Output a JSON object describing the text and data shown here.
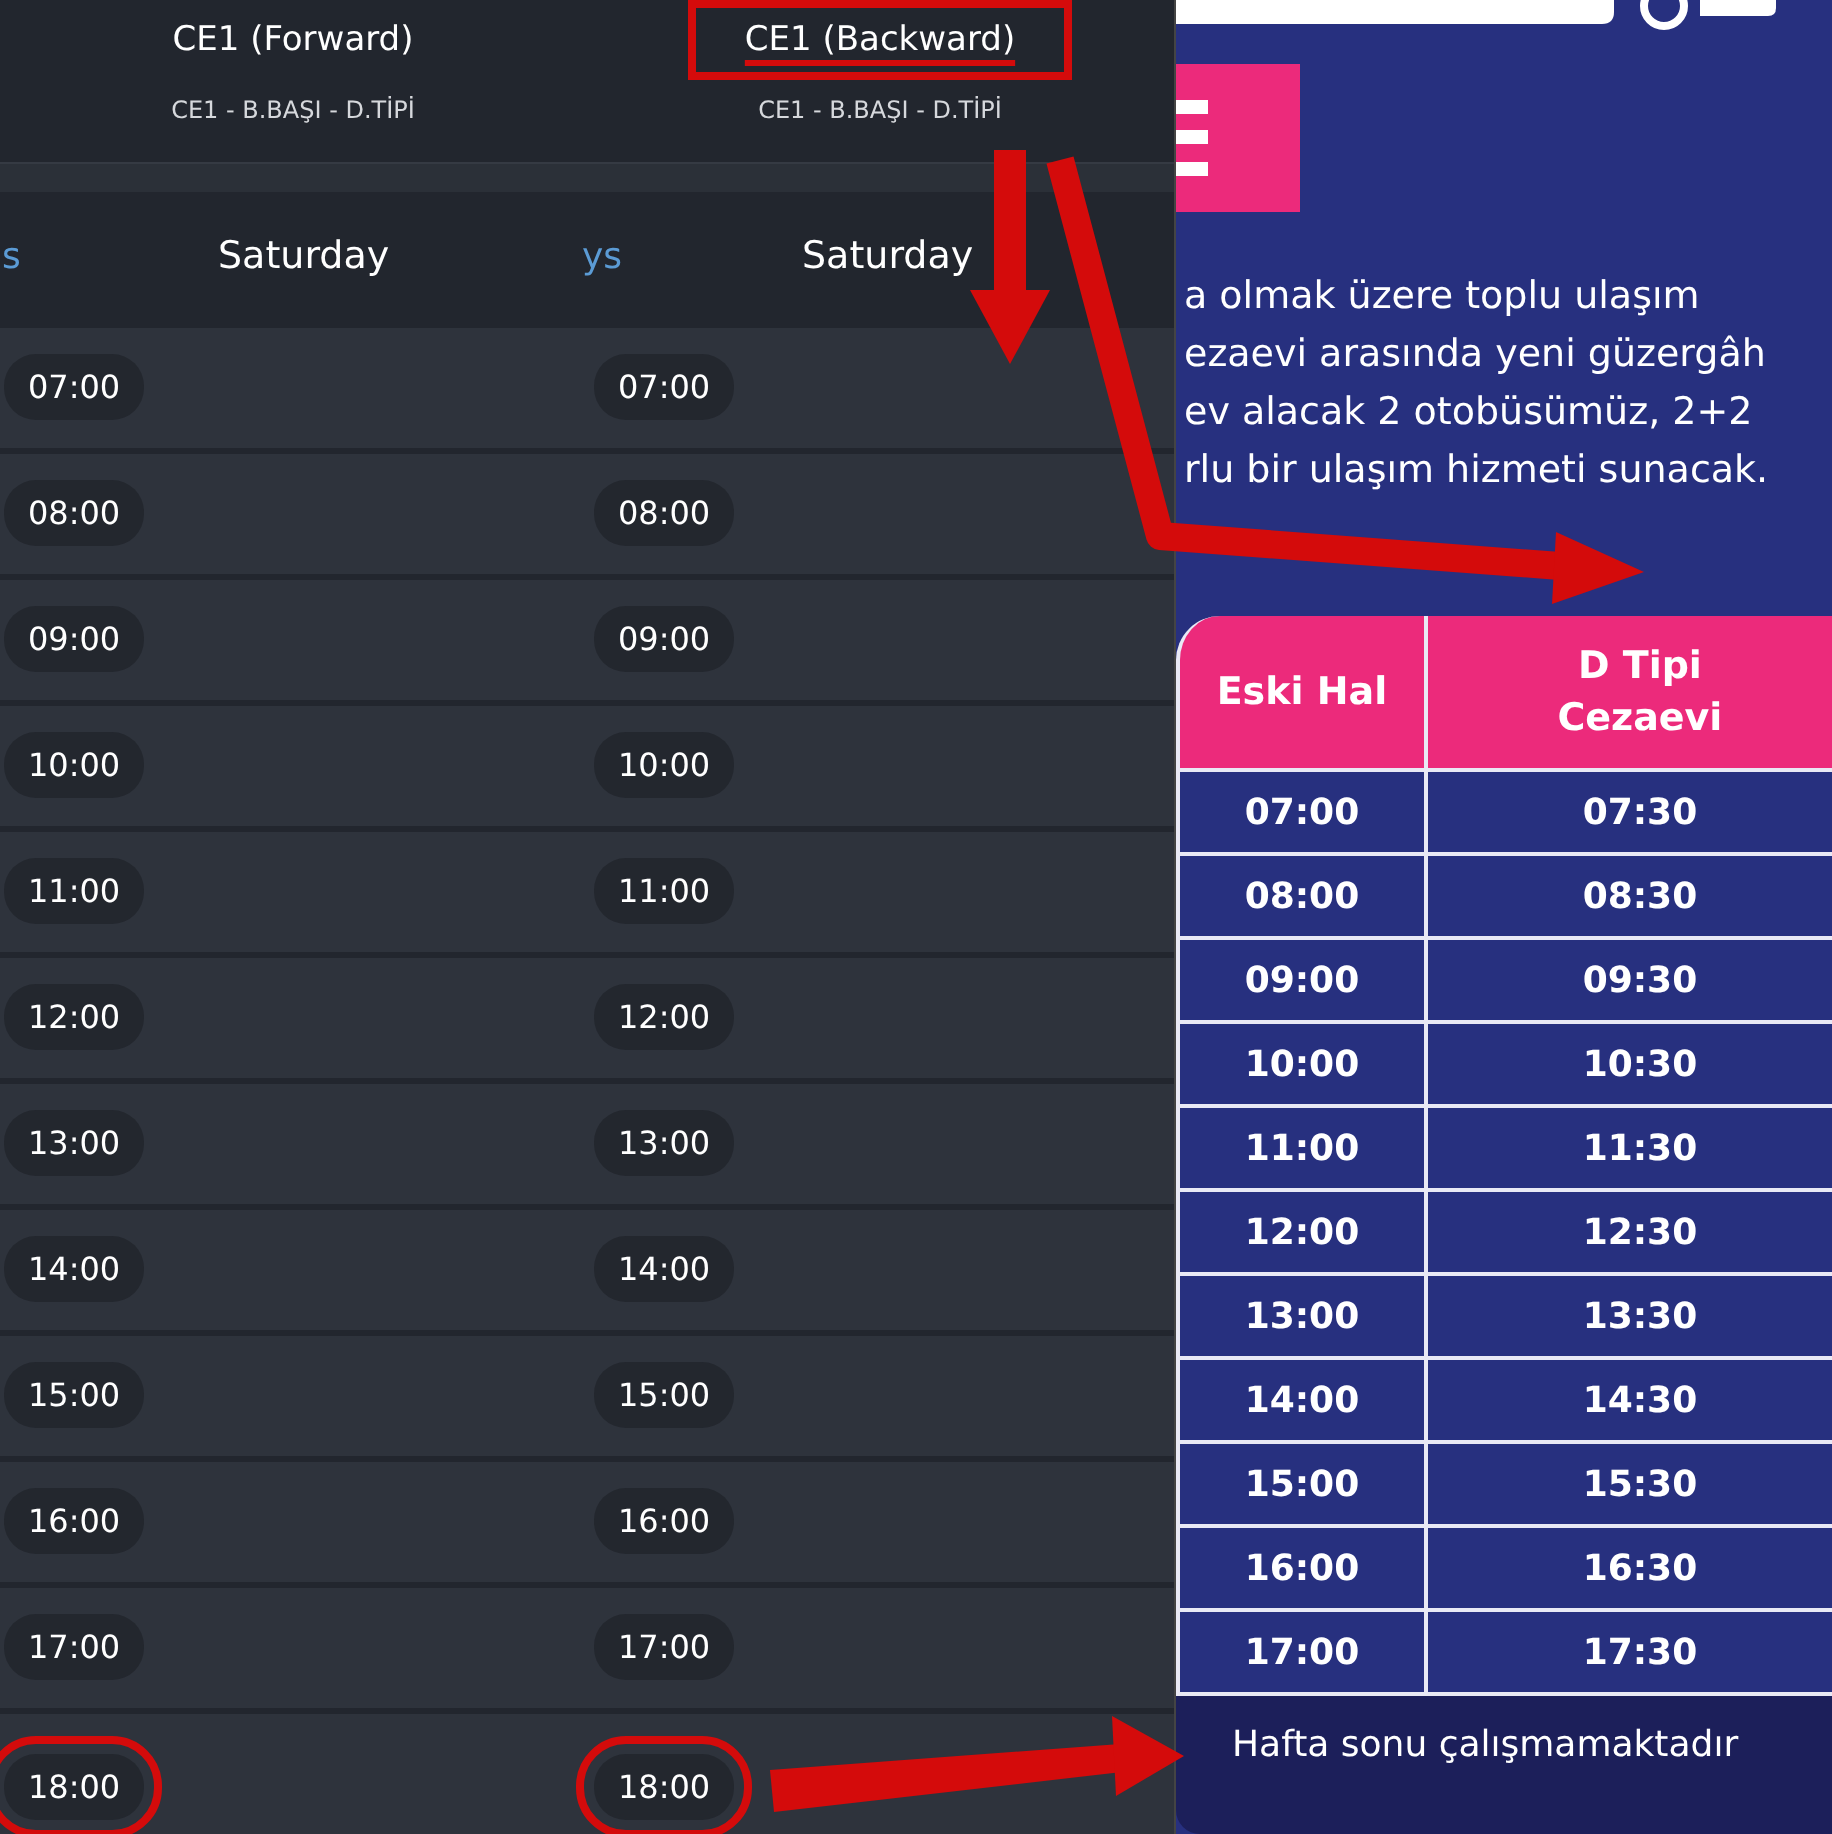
{
  "routes": [
    {
      "title": "CE1 (Forward)",
      "title_marked": false,
      "subtitle": "CE1 - B.BAŞI - D.TİPİ",
      "tab_partial": "s",
      "day": "Saturday",
      "times": [
        {
          "time": "07:00",
          "marked": false
        },
        {
          "time": "08:00",
          "marked": false
        },
        {
          "time": "09:00",
          "marked": false
        },
        {
          "time": "10:00",
          "marked": false
        },
        {
          "time": "11:00",
          "marked": false
        },
        {
          "time": "12:00",
          "marked": false
        },
        {
          "time": "13:00",
          "marked": false
        },
        {
          "time": "14:00",
          "marked": false
        },
        {
          "time": "15:00",
          "marked": false
        },
        {
          "time": "16:00",
          "marked": false
        },
        {
          "time": "17:00",
          "marked": false
        },
        {
          "time": "18:00",
          "marked": true
        }
      ]
    },
    {
      "title": "CE1 (Backward)",
      "title_marked": true,
      "subtitle": "CE1 - B.BAŞI - D.TİPİ",
      "tab_partial": "ys",
      "day": "Saturday",
      "times": [
        {
          "time": "07:00",
          "marked": false
        },
        {
          "time": "08:00",
          "marked": false
        },
        {
          "time": "09:00",
          "marked": false
        },
        {
          "time": "10:00",
          "marked": false
        },
        {
          "time": "11:00",
          "marked": false
        },
        {
          "time": "12:00",
          "marked": false
        },
        {
          "time": "13:00",
          "marked": false
        },
        {
          "time": "14:00",
          "marked": false
        },
        {
          "time": "15:00",
          "marked": false
        },
        {
          "time": "16:00",
          "marked": false
        },
        {
          "time": "17:00",
          "marked": false
        },
        {
          "time": "18:00",
          "marked": true
        }
      ]
    }
  ],
  "poster": {
    "paragraph_lines": [
      "a olmak üzere toplu ulaşım",
      "ezaevi arasında yeni güzergâh",
      "ev alacak 2 otobüsümüz, 2+2",
      "rlu bir ulaşım hizmeti sunacak."
    ],
    "table": {
      "columns": [
        "Eski Hal",
        "D Tipi Cezaevi"
      ],
      "rows": [
        [
          "07:00",
          "07:30"
        ],
        [
          "08:00",
          "08:30"
        ],
        [
          "09:00",
          "09:30"
        ],
        [
          "10:00",
          "10:30"
        ],
        [
          "11:00",
          "11:30"
        ],
        [
          "12:00",
          "12:30"
        ],
        [
          "13:00",
          "13:30"
        ],
        [
          "14:00",
          "14:30"
        ],
        [
          "15:00",
          "15:30"
        ],
        [
          "16:00",
          "16:30"
        ],
        [
          "17:00",
          "17:30"
        ]
      ]
    },
    "footer": "Hafta sonu çalışmamaktadır"
  }
}
